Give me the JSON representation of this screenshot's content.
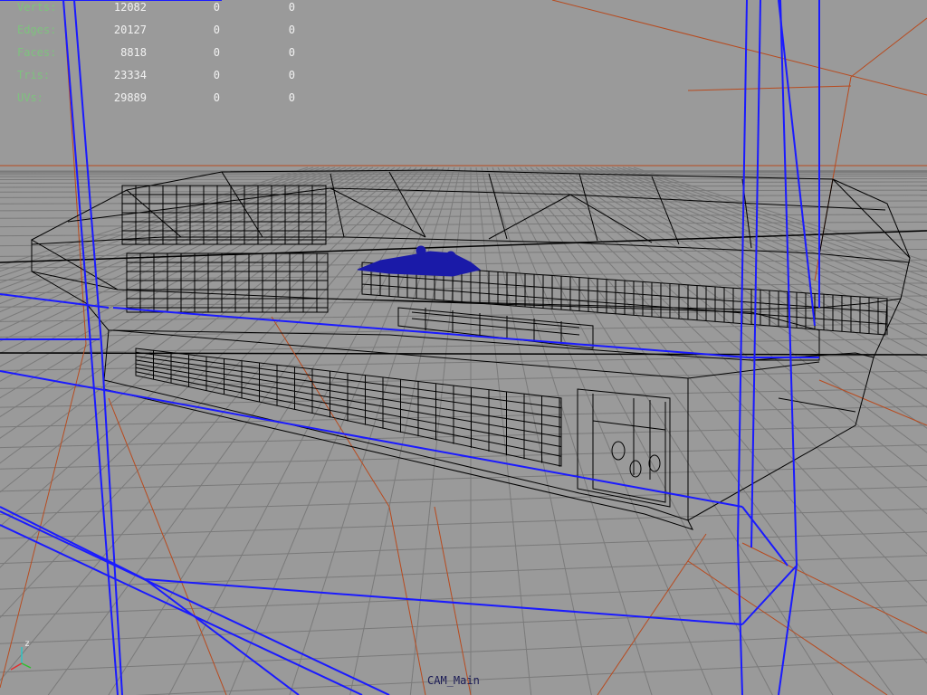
{
  "viewport": {
    "background": "#9a9a9a",
    "camera_label": "CAM_Main",
    "axis_labels": {
      "z": "z",
      "y": "y",
      "x": "x"
    }
  },
  "stats": {
    "rows": [
      {
        "label": "Verts:",
        "values": [
          "12082",
          "0",
          "0"
        ]
      },
      {
        "label": "Edges:",
        "values": [
          "20127",
          "0",
          "0"
        ]
      },
      {
        "label": "Faces:",
        "values": [
          "8818",
          "0",
          "0"
        ]
      },
      {
        "label": "Tris:",
        "values": [
          "23334",
          "0",
          "0"
        ]
      },
      {
        "label": "UVs:",
        "values": [
          "29889",
          "0",
          "0"
        ]
      }
    ]
  },
  "colors": {
    "grid": "#7a7a7a",
    "grid_axis": "#000000",
    "camera_frustum": "#1a1aff",
    "light_lines": "#b84a1e",
    "wireframe": "#000000",
    "selected_component": "#1a1aa8",
    "hud_label": "#7ec27e",
    "hud_value": "#f2f2f2"
  }
}
